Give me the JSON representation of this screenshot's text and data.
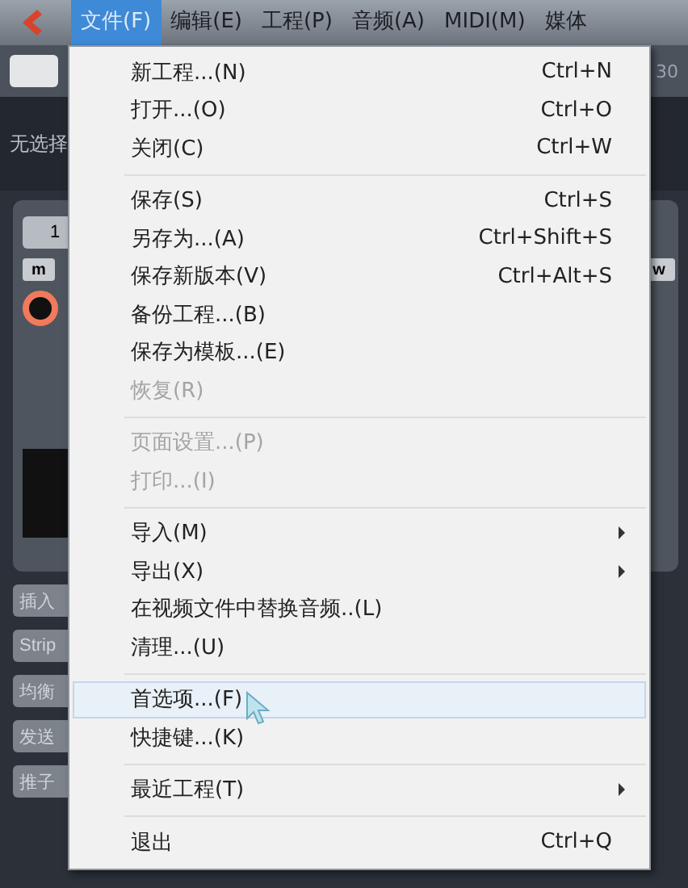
{
  "menubar": [
    {
      "label": "文件(F)",
      "selected": true
    },
    {
      "label": "编辑(E)",
      "selected": false
    },
    {
      "label": "工程(P)",
      "selected": false
    },
    {
      "label": "音频(A)",
      "selected": false
    },
    {
      "label": "MIDI(M)",
      "selected": false
    },
    {
      "label": "媒体",
      "selected": false
    }
  ],
  "toolbar": {
    "time_label": "30"
  },
  "status": {
    "text": "无选择"
  },
  "left_panel": {
    "channel_button": "1",
    "mute_button": "m",
    "write_button": "w",
    "section_buttons": [
      "插入",
      "Strip",
      "均衡",
      "发送",
      "推子"
    ]
  },
  "file_menu": [
    [
      {
        "label": "新工程...(N)",
        "shortcut": "Ctrl+N",
        "disabled": false,
        "has_submenu": false,
        "selected": false
      },
      {
        "label": "打开...(O)",
        "shortcut": "Ctrl+O",
        "disabled": false,
        "has_submenu": false,
        "selected": false
      },
      {
        "label": "关闭(C)",
        "shortcut": "Ctrl+W",
        "disabled": false,
        "has_submenu": false,
        "selected": false
      }
    ],
    [
      {
        "label": "保存(S)",
        "shortcut": "Ctrl+S",
        "disabled": false,
        "has_submenu": false,
        "selected": false
      },
      {
        "label": "另存为...(A)",
        "shortcut": "Ctrl+Shift+S",
        "disabled": false,
        "has_submenu": false,
        "selected": false
      },
      {
        "label": "保存新版本(V)",
        "shortcut": "Ctrl+Alt+S",
        "disabled": false,
        "has_submenu": false,
        "selected": false
      },
      {
        "label": "备份工程...(B)",
        "disabled": false,
        "has_submenu": false,
        "selected": false
      },
      {
        "label": "保存为模板...(E)",
        "disabled": false,
        "has_submenu": false,
        "selected": false
      },
      {
        "label": "恢复(R)",
        "disabled": true,
        "has_submenu": false,
        "selected": false
      }
    ],
    [
      {
        "label": "页面设置...(P)",
        "disabled": true,
        "has_submenu": false,
        "selected": false
      },
      {
        "label": "打印...(I)",
        "disabled": true,
        "has_submenu": false,
        "selected": false
      }
    ],
    [
      {
        "label": "导入(M)",
        "disabled": false,
        "has_submenu": true,
        "selected": false
      },
      {
        "label": "导出(X)",
        "disabled": false,
        "has_submenu": true,
        "selected": false
      },
      {
        "label": "在视频文件中替换音频..(L)",
        "disabled": false,
        "has_submenu": false,
        "selected": false
      },
      {
        "label": "清理...(U)",
        "disabled": false,
        "has_submenu": false,
        "selected": false
      }
    ],
    [
      {
        "label": "首选项...(F)",
        "disabled": false,
        "has_submenu": false,
        "selected": true
      },
      {
        "label": "快捷键...(K)",
        "disabled": false,
        "has_submenu": false,
        "selected": false
      }
    ],
    [
      {
        "label": "最近工程(T)",
        "disabled": false,
        "has_submenu": true,
        "selected": false
      }
    ],
    [
      {
        "label": "退出",
        "shortcut": "Ctrl+Q",
        "disabled": false,
        "has_submenu": false,
        "selected": false
      }
    ]
  ]
}
